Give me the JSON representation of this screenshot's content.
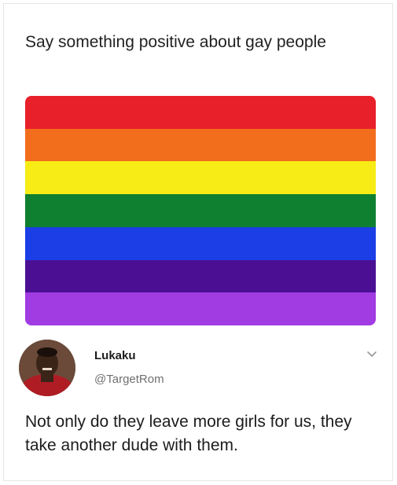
{
  "post": {
    "prompt_text": "Say something positive about gay people"
  },
  "flag": {
    "stripes": [
      "#e8202a",
      "#f26e1c",
      "#f7ec16",
      "#0f8030",
      "#1b3ee6",
      "#4b0f94",
      "#a13be2"
    ]
  },
  "reply": {
    "display_name": "Lukaku",
    "handle": "@TargetRom",
    "text": "Not only do they leave more girls for us, they take another dude with them.",
    "menu_icon": "chevron-down-icon",
    "avatar_icon": "profile-photo"
  }
}
